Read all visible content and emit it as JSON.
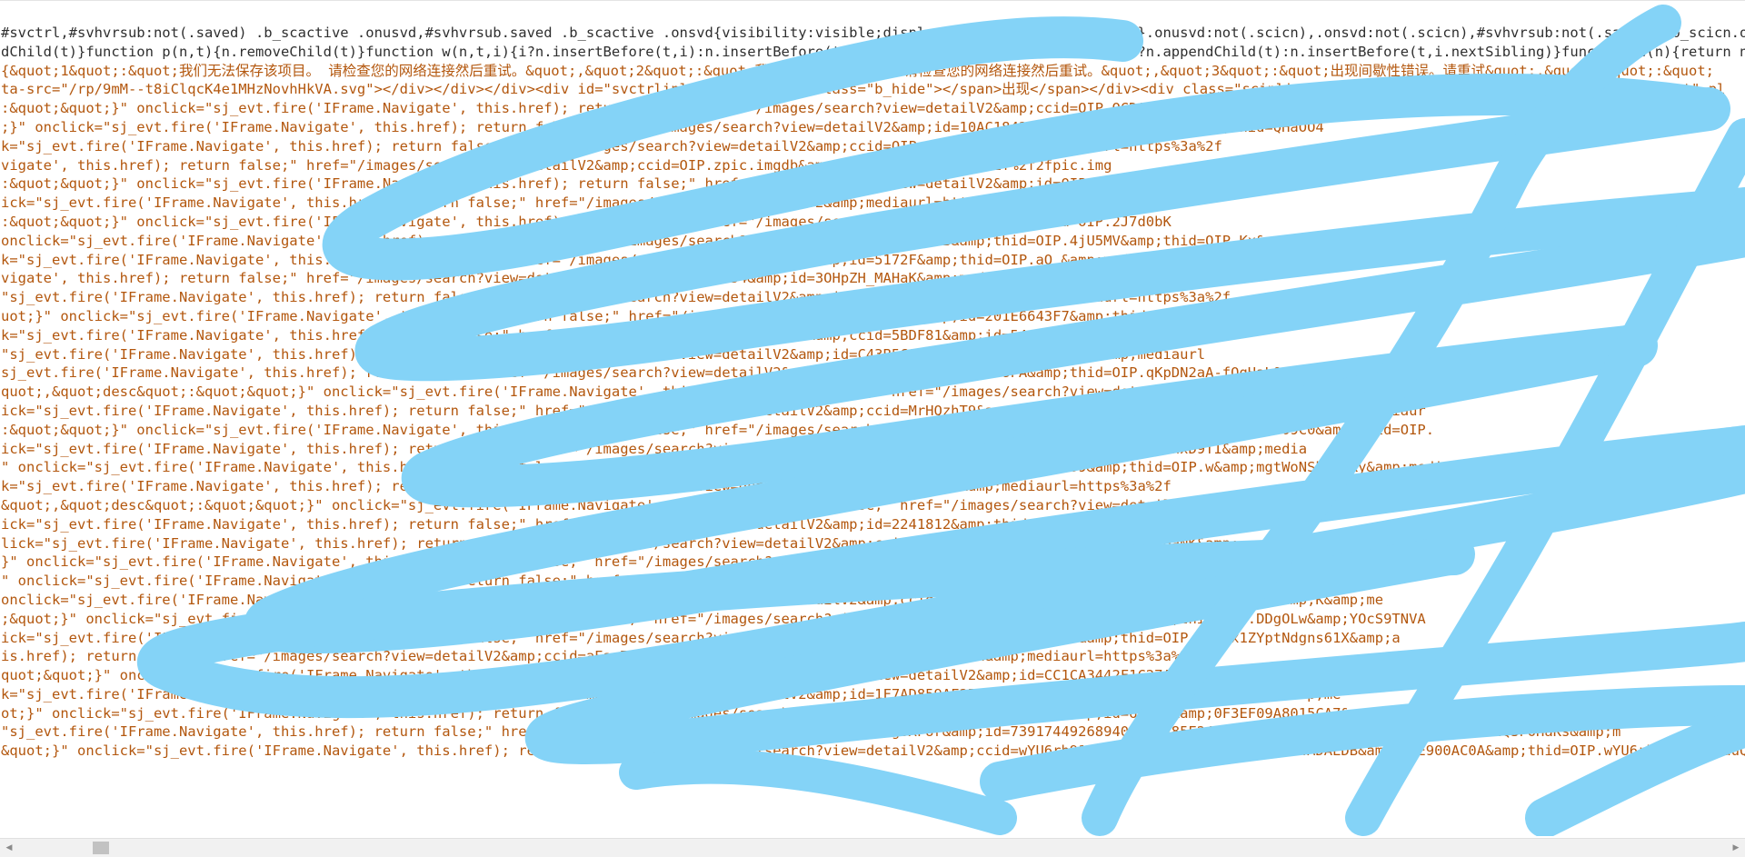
{
  "code_lines": [
    {
      "text": "#svctrl,#svhvrsub:not(.saved) .b_scactive .onusvd,#svhvrsub.saved .b_scactive .onsvd{visibility:visible;display:inline-block;opacity:1}.onusvd:not(.scicn),.onsvd:not(.scicn),#svhvrsub:not(.saved) .b_scicn.onsvd,.saved",
      "style": "dark"
    },
    {
      "text": "dChild(t)}function p(n,t){n.removeChild(t)}function w(n,t,i){i?n.insertBefore(t,i):n.insertBefore(t)}function b(n,t,i){n.lastchild===i?n.appendChild(t):n.insertBefore(t,i.nextSibling)}function c(n){return n.remove",
      "style": "dark"
    },
    {
      "text": "{&quot;1&quot;:&quot;我们无法保存该项目。 请检查您的网络连接然后重试。&quot;,&quot;2&quot;:&quot;我们无法删除此项目。 请检查您的网络连接然后重试。&quot;,&quot;3&quot;:&quot;出现间歇性错误。请重试&quot;,&quot;4&quot;:&quot;",
      "style": "orange"
    },
    {
      "text": "ta-src=\"/rp/9mM--t8iClqcK4e1MHzNovhHkVA.svg\"></div></div></div><div id=\"svctrlinlineformerrdup\" class=\"b_hide\"></span>出现</span></div><div class=\"scinline\"><input id=\"svctrlinlineformname\" type=\"text\" pl",
      "style": "orange"
    },
    {
      "text": ":&quot;&quot;}\" onclick=\"sj_evt.fire('IFrame.Navigate', this.href); return false;\" href=\"/images/search?view=detailV2&amp;ccid=OIP.QCDA4RfMFAGabk5",
      "style": "orange"
    },
    {
      "text": ";}\" onclick=\"sj_evt.fire('IFrame.Navigate', this.href); return false;\" href=\"/images/search?view=detailV2&amp;id=10AC1842&amp;thid=OIP.3AD0E&amp;thid=QHaOO4",
      "style": "orange"
    },
    {
      "text": "k=\"sj_evt.fire('IFrame.Navigate', this.href); return false;\" href=\"/images/search?view=detailV2&amp;ccid=OIP.FIDoHAHaKx&amp;mediaurl=https%3a%2f",
      "style": "orange"
    },
    {
      "text": "vigate', this.href); return false;\" href=\"/images/search?view=detailV2&amp;ccid=OIP.zpic.imgdb&amp;mediaurl=https%3a%2f%2f2fpic.img",
      "style": "orange"
    },
    {
      "text": ":&quot;&quot;}\" onclick=\"sj_evt.fire('IFrame.Navigate', this.href); return false;\" href=\"/images/search?view=detailV2&amp;id=OIP.YEdakTYY",
      "style": "orange"
    },
    {
      "text": "ick=\"sj_evt.fire('IFrame.Navigate', this.href); return false;\" href=\"/images/search?view=detailV2&amp;mediaurl=https%3a%2f%2f;mediaur",
      "style": "orange"
    },
    {
      "text": ":&quot;&quot;}\" onclick=\"sj_evt.fire('IFrame.Navigate', this.href); return false;\" href=\"/images/search?view=detailV2&amp;thid=OIP.2J7d0bK",
      "style": "orange"
    },
    {
      "text": "onclick=\"sj_evt.fire('IFrame.Navigate', this.href); return false;\" href=\"/images/search?view=detailV2&amp;id=1EB&amp;thid=OIP.4jU5MV&amp;thid=OIP.Kx&amp;me",
      "style": "orange"
    },
    {
      "text": "k=\"sj_evt.fire('IFrame.Navigate', this.href); return false;\" href=\"/images/search?view=detailV2&amp;id=5172F&amp;thid=OIP.aO_&amp;mediaurl=https%3a%2f&amp;media",
      "style": "orange"
    },
    {
      "text": "vigate', this.href); return false;\" href=\"/images/search?view=detailV2&amp;ccid=OIP.NS54&amp;id=3OHpZH_MAHaK&amp;mediaurl=https%3a%2f%2fgdb",
      "style": "orange"
    },
    {
      "text": "\"sj_evt.fire('IFrame.Navigate', this.href); return false;\" href=\"/images/search?view=detailV2&amp;id=E01A&amp;thid=OIP.3&amp;mediaurl=https%3a%2f",
      "style": "orange"
    },
    {
      "text": "uot;}\" onclick=\"sj_evt.fire('IFrame.Navigate', this.href); return false;\" href=\"/images/search?view=detailV2&amp;id=201E6643F7&amp;thid=OIP.IwHaK",
      "style": "orange"
    },
    {
      "text": "k=\"sj_evt.fire('IFrame.Navigate', this.href); return false;\" href=\"/images/search?view=detailV2&amp;ccid=5BDF81&amp;id=54CD1C16A0&amp;mediaur",
      "style": "orange"
    },
    {
      "text": "\"sj_evt.fire('IFrame.Navigate', this.href); return false;\" href=\"/images/search?view=detailV2&amp;id=C43B5C&amp;thid=OIP.ZwJFwHaL&amp;mediaurl",
      "style": "orange"
    },
    {
      "text": "sj_evt.fire('IFrame.Navigate', this.href); return false;\" href=\"/images/search?view=detailV2&amp;id=EB1C&amp;thid=OIP.8FA&amp;thid=OIP.qKpDN2aA-fQgHaL&amp;m",
      "style": "orange"
    },
    {
      "text": "quot;,&quot;desc&quot;:&quot;&quot;}\" onclick=\"sj_evt.fire('IFrame.Navigate', this.href); return false;\" href=\"/images/search?view=detailV2&amp;id=4E10167FA78976AE394",
      "style": "orange"
    },
    {
      "text": "ick=\"sj_evt.fire('IFrame.Navigate', this.href); return false;\" href=\"/images/search?view=detailV2&amp;ccid=MrHQzhT9&amp;id=4F73E1F980&amp;thid=OIP.MrHQzhT9E&amp;mediaur",
      "style": "orange"
    },
    {
      "text": ":&quot;&quot;}\" onclick=\"sj_evt.fire('IFrame.Navigate', this.href); return false;\" href=\"/images/search?view=detailV2&amp;ccid=W2&amp;id=DB5F0&amp;37D909C0&amp;thid=OIP.",
      "style": "orange"
    },
    {
      "text": "ick=\"sj_evt.fire('IFrame.Navigate', this.href); return false;\" href=\"/images/search?view=detailV2&amp;id=65&amp;id=8ECCF&amp;thid=OIP.dnIXhxD9TI&amp;media",
      "style": "orange"
    },
    {
      "text": "\" onclick=\"sj_evt.fire('IFrame.Navigate', this.href); return false;\" href=\"/images/search?view=detailV2&amp;id=h38&amp;id=2EA309&amp;thid=OIP.w&amp;mgtWoNShOHaKy&amp;media",
      "style": "orange"
    },
    {
      "text": "k=\"sj_evt.fire('IFrame.Navigate', this.href); return false;\" href=\"/images/search?view=detailV2&amp;ccid=&amp;id=&amp;mediaurl=https%3a%2f",
      "style": "orange"
    },
    {
      "text": "&quot;,&quot;desc&quot;:&quot;&quot;}\" onclick=\"sj_evt.fire('IFrame.Navigate', this.href); return false;\" href=\"/images/search?view=detailV2&amp;id=BDD67C99B8CB69208",
      "style": "orange"
    },
    {
      "text": "ick=\"sj_evt.fire('IFrame.Navigate', this.href); return false;\" href=\"/images/search?view=detailV2&amp;id=2241812&amp;thid=OIP.1ZuszggU&amp;mediaurl",
      "style": "orange"
    },
    {
      "text": "lick=\"sj_evt.fire('IFrame.Navigate', this.href); return false;\" href=\"/images/search?view=detailV2&amp;ccid=&amp;id=19DD2C&amp;thid=OIP.xHaNK&amp;",
      "style": "orange"
    },
    {
      "text": "}\" onclick=\"sj_evt.fire('IFrame.Navigate', this.href); return false;\" href=\"/images/search?view=detailV2&amp;id=6DBA16&amp;thid=OIP.Drk58IZDgQGL8PHaLH&amp;",
      "style": "orange"
    },
    {
      "text": "\" onclick=\"sj_evt.fire('IFrame.Navigate', this.href); return false;\" href=\"/images/search?view=detailV2&amp;id=39A12F6F&amp;thid=OIP_7e7rwmjmaxEg4Od&amp;aNK&amp;",
      "style": "orange"
    },
    {
      "text": "onclick=\"sj_evt.fire('IFrame.Navigate', this.href); return false;\" href=\"/images/search?view=detailV2&amp;ccid=98558&amp;thid=OIP.4Cf1aVvT9hzWR7z1NjP7&amp;K&amp;me",
      "style": "orange"
    },
    {
      "text": ";&quot;}\" onclick=\"sj_evt.fire('IFrame.Navigate', this.href); return false;\" href=\"/images/search?view=detailV2&amp;id=B3C26D&amp;C25C&amp;thid=OIP.DDgOLw&amp;YOcS9TNVA",
      "style": "orange"
    },
    {
      "text": "ick=\"sj_evt.fire('IFrame.Navigate', this.href); return false;\" href=\"/images/search?view=detailV2&amp;id=VEP&amp;DAFF&amp;81F3A&amp;thid=OIP.VEPDx1ZYptNdgns61X&amp;a",
      "style": "orange"
    },
    {
      "text": "is.href); return false;\" href=\"/images/search?view=detailV2&amp;ccid=aEac7&amp;id=76DC6DC2F&amp;thid=OIP.aEac7oBAaLH&amp;mediaurl=https%3a%2f%2f",
      "style": "orange"
    },
    {
      "text": "quot;&quot;}\" onclick=\"sj_evt.fire('IFrame.Navigate', this.href); return false;\" href=\"/images/search?view=detailV2&amp;id=CC1CA3442F1C27A8E3F1&amp;thid=OIP.dbE0KY23F",
      "style": "orange"
    },
    {
      "text": "k=\"sj_evt.fire('IFrame.Navigate', this.href); return false;\" href=\"/images/search?view=detailV2&amp;id=1F7AD859AF2B1D8BB0&amp;91&amp;thid=OIP.I&amp;aLH&amp;me",
      "style": "orange"
    },
    {
      "text": "ot;}\" onclick=\"sj_evt.fire('IFrame.Navigate', this.href); return false;\" href=\"/images/search?view=detailV2&amp;ccid=bKtAcics&amp;id=6B7B1&amp;0F3EF09A8015CA7&amp;Vz8Fg3Ac",
      "style": "orange"
    },
    {
      "text": "\"sj_evt.fire('IFrame.Navigate', this.href); return false;\" href=\"/images/search?view=detailV2&amp;ccid=wrgUXFUr&amp;id=739174492689400A2F485E24A4AF22&amp;thid=OIP.rgUXFU&amp;4btQSFOHaKs&amp;m",
      "style": "orange"
    },
    {
      "text": "&quot;}\" onclick=\"sj_evt.fire('IFrame.Navigate', this.href); return false;\" href=\"/images/search?view=detailV2&amp;ccid=wYU6rh914&amp;87067C&amp;10EEA6884ADAEDB&amp;16E900AC0A&amp;thid=OIP.wYU6rh&amp;AcOduQH",
      "style": "orange"
    }
  ],
  "scrollbar": {
    "left_arrow": "◀",
    "right_arrow": "▶"
  },
  "colors": {
    "scribble": "#84d3f7",
    "orange_text": "#b3570e",
    "dark_text": "#2f2f2f"
  }
}
